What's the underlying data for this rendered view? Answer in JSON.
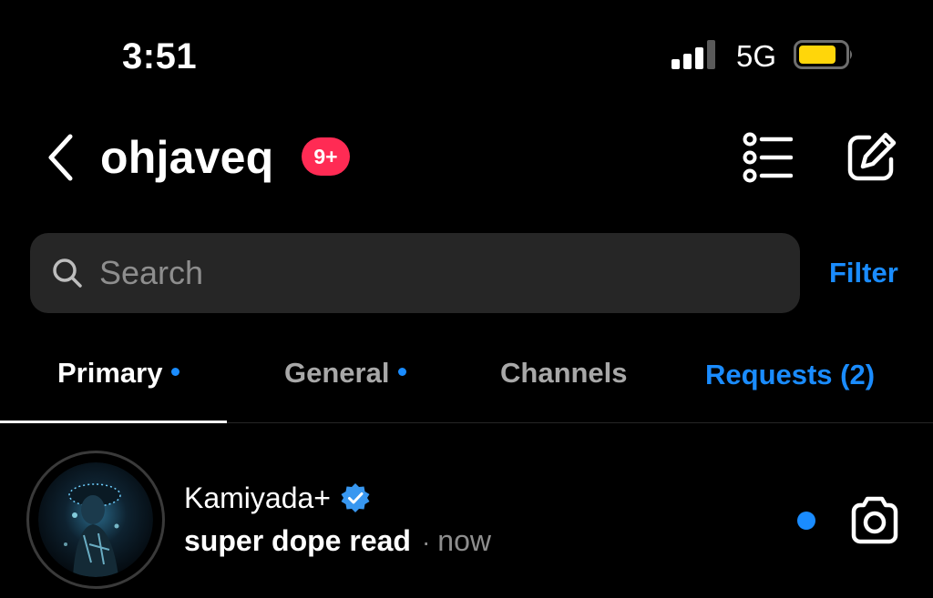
{
  "status_bar": {
    "time": "3:51",
    "network": "5G",
    "signal_icon": "cellular-signal-icon",
    "battery_icon": "battery-icon",
    "battery_color": "#ffd60a"
  },
  "header": {
    "back_icon": "chevron-left-icon",
    "username": "ohjaveq",
    "badge": "9+",
    "badge_color": "#ff2b54",
    "list_icon": "list-icon",
    "compose_icon": "compose-icon"
  },
  "search": {
    "placeholder": "Search",
    "icon": "search-icon",
    "filter_label": "Filter"
  },
  "tabs": [
    {
      "label": "Primary",
      "active": true,
      "dot": true
    },
    {
      "label": "General",
      "active": false,
      "dot": true
    },
    {
      "label": "Channels",
      "active": false,
      "dot": false
    },
    {
      "label": "Requests (2)",
      "active": false,
      "dot": false
    }
  ],
  "conversations": [
    {
      "name": "Kamiyada+",
      "verified": true,
      "message": "super dope read",
      "separator": "·",
      "time": "now",
      "unread": true,
      "action_icon": "camera-icon"
    }
  ],
  "colors": {
    "accent": "#1a8cff",
    "background": "#000000",
    "search_bg": "#262626",
    "muted_text": "#a8a8a8"
  }
}
